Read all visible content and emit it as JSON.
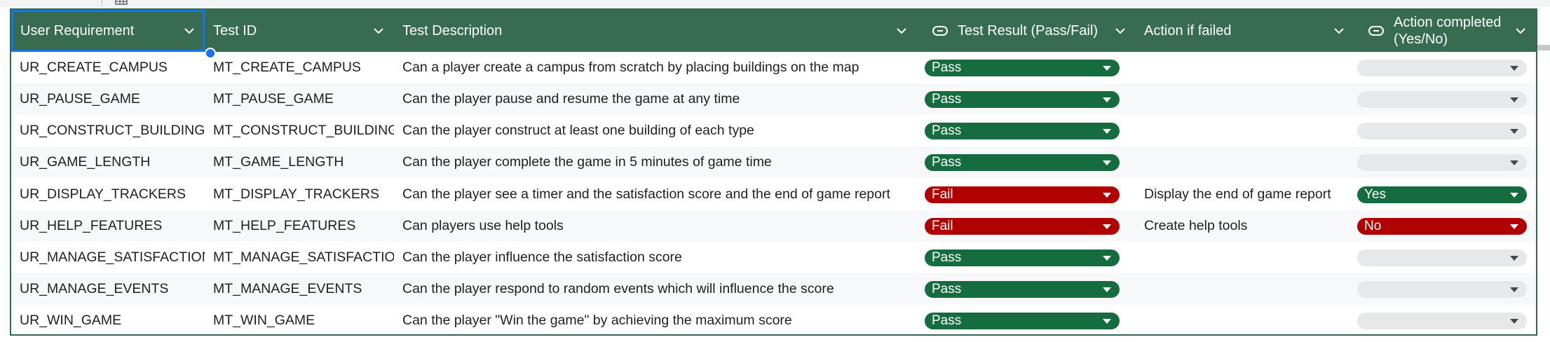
{
  "columns": [
    {
      "key": "req",
      "label": "User Requirement"
    },
    {
      "key": "id",
      "label": "Test ID"
    },
    {
      "key": "desc",
      "label": "Test Description"
    },
    {
      "key": "result",
      "label": "Test Result (Pass/Fail)"
    },
    {
      "key": "action",
      "label": "Action if failed"
    },
    {
      "key": "done",
      "label": "Action completed (Yes/No)"
    }
  ],
  "rows": [
    {
      "req": "UR_CREATE_CAMPUS",
      "id": "MT_CREATE_CAMPUS",
      "desc": "Can a player create a campus from scratch by placing buildings on the map",
      "result": "Pass",
      "action": "",
      "done": ""
    },
    {
      "req": "UR_PAUSE_GAME",
      "id": "MT_PAUSE_GAME",
      "desc": "Can the player pause and resume the game at any time",
      "result": "Pass",
      "action": "",
      "done": ""
    },
    {
      "req": "UR_CONSTRUCT_BUILDINGS",
      "id": "MT_CONSTRUCT_BUILDINGS",
      "desc": "Can the player construct at least one building of each type",
      "result": "Pass",
      "action": "",
      "done": ""
    },
    {
      "req": "UR_GAME_LENGTH",
      "id": "MT_GAME_LENGTH",
      "desc": "Can the player complete the game in 5 minutes of game time",
      "result": "Pass",
      "action": "",
      "done": ""
    },
    {
      "req": "UR_DISPLAY_TRACKERS",
      "id": "MT_DISPLAY_TRACKERS",
      "desc": "Can the player see a timer and the satisfaction score and the end of game report",
      "result": "Fail",
      "action": "Display the end of game report",
      "done": "Yes"
    },
    {
      "req": "UR_HELP_FEATURES",
      "id": "MT_HELP_FEATURES",
      "desc": "Can players use help tools",
      "result": "Fail",
      "action": "Create help tools",
      "done": "No"
    },
    {
      "req": "UR_MANAGE_SATISFACTION",
      "id": "MT_MANAGE_SATISFACTION",
      "desc": "Can the player influence the satisfaction score",
      "result": "Pass",
      "action": "",
      "done": ""
    },
    {
      "req": "UR_MANAGE_EVENTS",
      "id": "MT_MANAGE_EVENTS",
      "desc": "Can the player respond to random events which will influence the score",
      "result": "Pass",
      "action": "",
      "done": ""
    },
    {
      "req": "UR_WIN_GAME",
      "id": "MT_WIN_GAME",
      "desc": "Can the player \"Win the game\" by achieving the maximum score",
      "result": "Pass",
      "action": "",
      "done": ""
    }
  ],
  "colors": {
    "header": "#386c52",
    "pass": "#146c3f",
    "fail": "#b10202",
    "empty_chip": "#e7e8ea",
    "selection": "#1a73e8"
  }
}
